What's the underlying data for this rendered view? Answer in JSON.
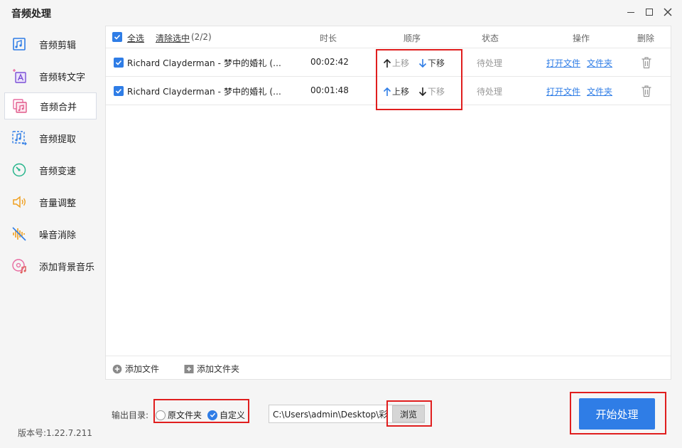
{
  "window": {
    "title": "音频处理",
    "controls": [
      "minimize-icon",
      "maximize-icon",
      "close-icon"
    ]
  },
  "sidebar": {
    "items": [
      {
        "label": "音频剪辑",
        "icon": "audio-cut-icon",
        "active": false
      },
      {
        "label": "音频转文字",
        "icon": "audio-to-text-icon",
        "active": false
      },
      {
        "label": "音频合并",
        "icon": "audio-merge-icon",
        "active": true
      },
      {
        "label": "音频提取",
        "icon": "audio-extract-icon",
        "active": false
      },
      {
        "label": "音频变速",
        "icon": "audio-speed-icon",
        "active": false
      },
      {
        "label": "音量调整",
        "icon": "volume-icon",
        "active": false
      },
      {
        "label": "噪音消除",
        "icon": "noise-removal-icon",
        "active": false
      },
      {
        "label": "添加背景音乐",
        "icon": "background-music-icon",
        "active": false
      }
    ],
    "version": "版本号:1.22.7.211"
  },
  "table": {
    "select_all": "全选",
    "clear_selected": "清除选中",
    "selected_count": "(2/2)",
    "headers": {
      "duration": "时长",
      "order": "顺序",
      "status": "状态",
      "actions": "操作",
      "delete": "删除"
    },
    "rows": [
      {
        "checked": true,
        "name": "Richard Clayderman - 梦中的婚礼 (...",
        "duration": "00:02:42",
        "move_up": "上移",
        "move_up_enabled": false,
        "move_down": "下移",
        "move_down_enabled": true,
        "status": "待处理",
        "open_file": "打开文件",
        "folder": "文件夹"
      },
      {
        "checked": true,
        "name": "Richard Clayderman - 梦中的婚礼 (...",
        "duration": "00:01:48",
        "move_up": "上移",
        "move_up_enabled": true,
        "move_down": "下移",
        "move_down_enabled": false,
        "status": "待处理",
        "open_file": "打开文件",
        "folder": "文件夹"
      }
    ],
    "add_file": "添加文件",
    "add_folder": "添加文件夹"
  },
  "output": {
    "label": "输出目录:",
    "option_original": "原文件夹",
    "option_custom": "自定义",
    "selected": "自定义",
    "path": "C:\\Users\\admin\\Desktop\\彩",
    "browse": "浏览"
  },
  "start_button": "开始处理",
  "colors": {
    "accent": "#2f7de6",
    "highlight": "#e01e1e",
    "muted": "#999999"
  }
}
